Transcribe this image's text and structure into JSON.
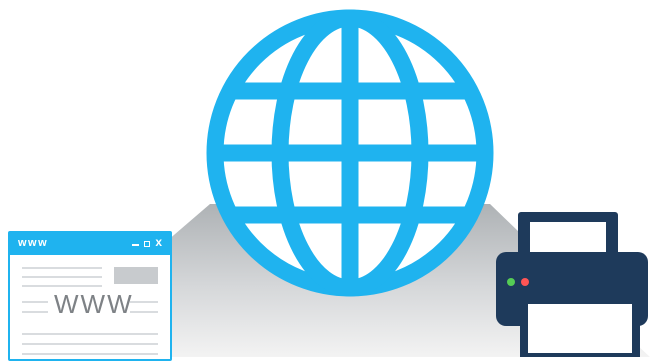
{
  "illustration": {
    "globe_color": "#1fb3ef",
    "printer_color": "#1e3a5b",
    "browser_accent": "#1fb3ef"
  },
  "browser": {
    "title": "www",
    "content_text": "WWW",
    "controls": [
      "minimize-icon",
      "maximize-icon",
      "close-icon"
    ],
    "close_label": "x"
  },
  "printer": {
    "indicator_colors": [
      "#55cc55",
      "#ff5555"
    ]
  },
  "icons": [
    "globe-icon",
    "browser-window-icon",
    "printer-icon"
  ]
}
